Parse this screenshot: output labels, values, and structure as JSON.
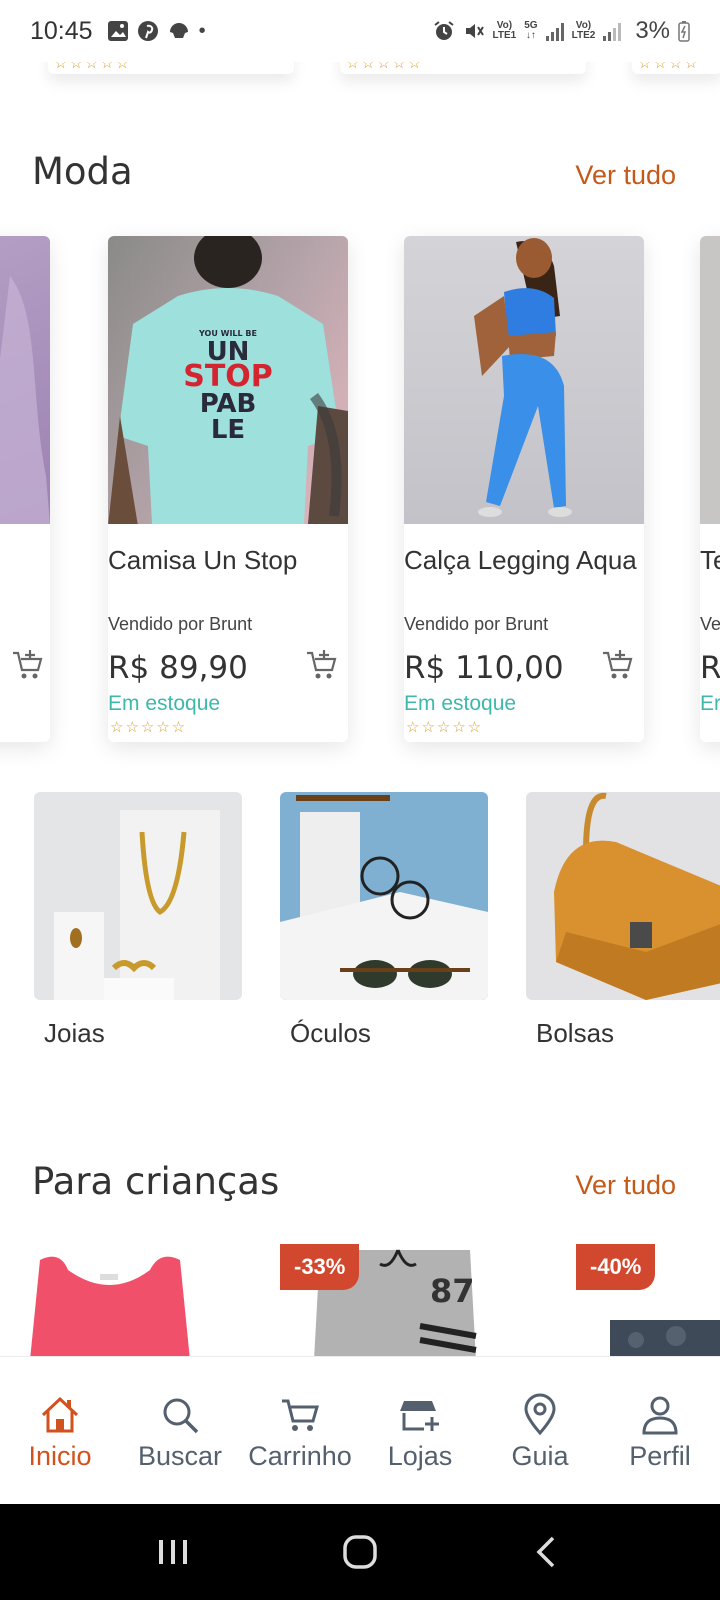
{
  "status_bar": {
    "time": "10:45",
    "lte1": "LTE1",
    "lte2": "LTE2",
    "net": "5G",
    "battery": "3%"
  },
  "sections": {
    "moda": {
      "title": "Moda",
      "see_all": "Ver tudo"
    },
    "kids": {
      "title": "Para crianças",
      "see_all": "Ver tudo"
    }
  },
  "products": [
    {
      "name": "Camisa Un Stop",
      "seller": "Vendido por Brunt",
      "price": "R$ 89,90",
      "stock": "Em estoque",
      "rating": "☆☆☆☆☆",
      "shirt_text_1": "YOU WILL BE",
      "shirt_text_2": "UN",
      "shirt_text_3": "STOP",
      "shirt_text_4": "PAB",
      "shirt_text_5": "LE"
    },
    {
      "name": "Calça Legging Aqua",
      "seller": "Vendido por Brunt",
      "price": "R$ 110,00",
      "stock": "Em estoque",
      "rating": "☆☆☆☆☆"
    }
  ],
  "partial_cards": {
    "right_name": "Te",
    "right_seller": "Ve",
    "right_price": "R",
    "right_stock": "Er"
  },
  "categories": [
    {
      "label": "Joias"
    },
    {
      "label": "Óculos"
    },
    {
      "label": "Bolsas"
    }
  ],
  "kids_products": [
    {
      "discount": ""
    },
    {
      "discount": "-33%",
      "jersey_number": "87"
    },
    {
      "discount": "-40%"
    }
  ],
  "top_ratings": [
    "☆☆☆☆☆",
    "☆☆☆☆☆",
    "☆☆☆☆"
  ],
  "bottom_nav": [
    {
      "label": "Inicio",
      "icon": "home-icon",
      "active": true
    },
    {
      "label": "Buscar",
      "icon": "search-icon",
      "active": false
    },
    {
      "label": "Carrinho",
      "icon": "cart-icon",
      "active": false
    },
    {
      "label": "Lojas",
      "icon": "store-icon",
      "active": false
    },
    {
      "label": "Guia",
      "icon": "location-pin-icon",
      "active": false
    },
    {
      "label": "Perfil",
      "icon": "user-icon",
      "active": false
    }
  ],
  "colors": {
    "accent": "#d2521e",
    "see_all": "#c45a19",
    "in_stock": "#3fb8ac",
    "discount_badge": "#d2482e",
    "nav_inactive": "#55606e"
  }
}
